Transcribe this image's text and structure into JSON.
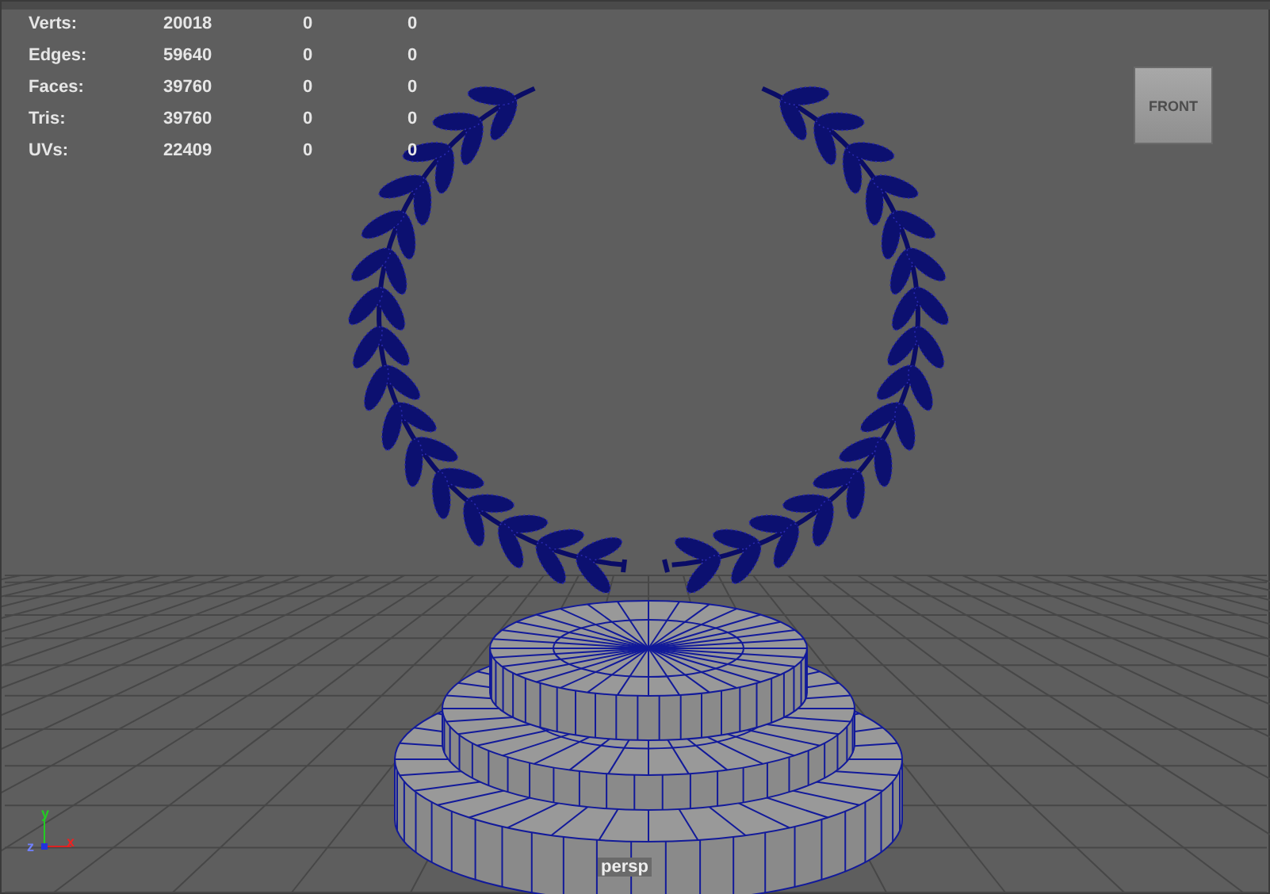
{
  "hud_stats": [
    {
      "label": "Verts:",
      "values": [
        "20018",
        "0",
        "0"
      ]
    },
    {
      "label": "Edges:",
      "values": [
        "59640",
        "0",
        "0"
      ]
    },
    {
      "label": "Faces:",
      "values": [
        "39760",
        "0",
        "0"
      ]
    },
    {
      "label": "Tris:",
      "values": [
        "39760",
        "0",
        "0"
      ]
    },
    {
      "label": "UVs:",
      "values": [
        "22409",
        "0",
        "0"
      ]
    }
  ],
  "view_cube": {
    "label": "FRONT"
  },
  "axis_indicator": {
    "x_label": "x",
    "y_label": "y",
    "z_label": "z"
  },
  "camera_label": "persp"
}
